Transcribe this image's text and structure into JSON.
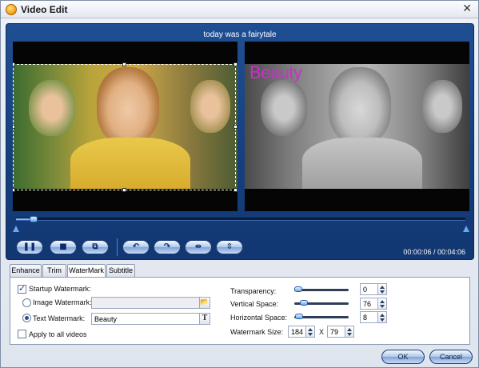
{
  "window": {
    "title": "Video Edit",
    "close_glyph": "✕",
    "app_icon": "app-logo-icon"
  },
  "preview": {
    "file_title": "today was a fairytale",
    "watermark_preview_text": "Beauty",
    "playback_progress": 0.04,
    "time": "00:00:06 / 00:04:06"
  },
  "controls": {
    "pause_glyph": "❚❚",
    "stop_glyph": "■",
    "snapshot_glyph": "⧉",
    "rotate_left_glyph": "↶",
    "rotate_right_glyph": "↷",
    "flip_h_glyph": "⇹",
    "flip_v_glyph": "⇳"
  },
  "tabs": [
    {
      "label": "Enhance",
      "active": false
    },
    {
      "label": "Trim",
      "active": false
    },
    {
      "label": "WaterMark",
      "active": true
    },
    {
      "label": "Subtitle",
      "active": false
    }
  ],
  "watermark": {
    "startup_label": "Startup Watermark:",
    "startup_checked": true,
    "image_label": "Image Watermark:",
    "image_path": "",
    "browse_glyph": "📂",
    "text_label": "Text Watermark:",
    "text_value": "Beauty",
    "font_glyph": "T",
    "apply_all_label": "Apply to all videos",
    "apply_all_checked": false,
    "transparency_label": "Transparency:",
    "transparency_value": "0",
    "transparency_level": 0.0,
    "vertical_label": "Vertical Space:",
    "vertical_value": "76",
    "vertical_level": 0.12,
    "horizontal_label": "Horizontal Space:",
    "horizontal_value": "8",
    "horizontal_level": 0.02,
    "size_label": "Watermark Size:",
    "size_width": "184",
    "size_x": "X",
    "size_height": "79"
  },
  "buttons": {
    "ok": "OK",
    "cancel": "Cancel"
  }
}
